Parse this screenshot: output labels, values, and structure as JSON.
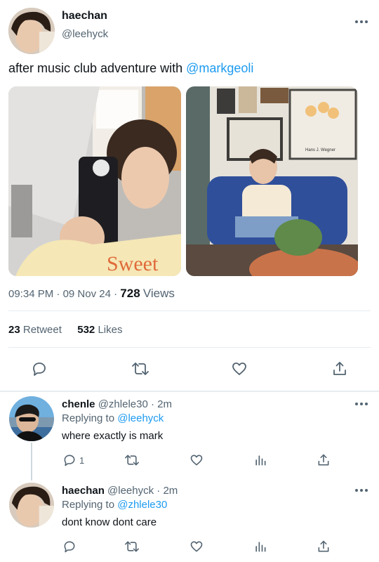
{
  "main_tweet": {
    "author_name": "haechan",
    "author_handle": "@leehyck",
    "text_prefix": "after music club adventure with ",
    "mention": "@markgeoli",
    "time": "09:34 PM",
    "date": "09 Nov 24",
    "views_count": "728",
    "views_label": "Views",
    "retweets_count": "23",
    "retweets_label": "Retweet",
    "likes_count": "532",
    "likes_label": "Likes",
    "photo2_sign_text": "Hans J. Wegner",
    "shirt_text": "Sweet"
  },
  "replies": [
    {
      "author_name": "chenle",
      "author_handle": "@zhlele30",
      "time_ago": "2m",
      "replying_label": "Replying to",
      "replying_to": "@leehyck",
      "text": "where exactly is mark",
      "reply_count": "1"
    },
    {
      "author_name": "haechan",
      "author_handle": "@leehyck",
      "time_ago": "2m",
      "replying_label": "Replying to",
      "replying_to": "@zhlele30",
      "text": "dont know dont care",
      "reply_count": ""
    }
  ],
  "separators": {
    "dot": "·"
  },
  "icons": {
    "more": "more-horizontal-icon",
    "reply": "reply-icon",
    "retweet": "retweet-icon",
    "like": "heart-icon",
    "analytics": "analytics-icon",
    "share": "share-icon"
  },
  "colors": {
    "link": "#1d9bf0",
    "muted": "#536471",
    "text": "#0f1419"
  }
}
